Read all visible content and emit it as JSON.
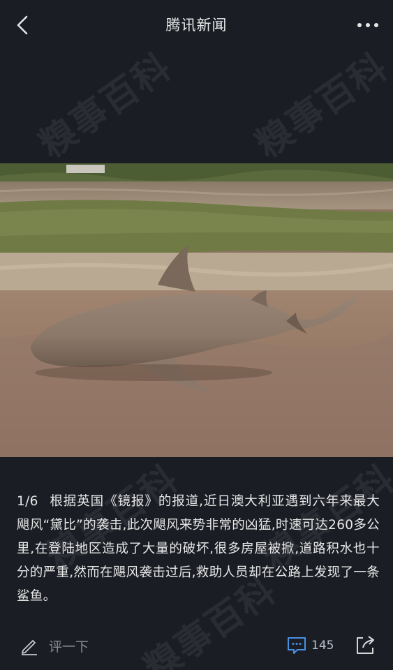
{
  "header": {
    "back_icon": "chevron-left-icon",
    "title": "腾讯新闻",
    "more_icon": "more-dots-icon"
  },
  "watermark": {
    "text": "糗事百科"
  },
  "photo": {
    "subject": "shark-on-flooded-road"
  },
  "caption": {
    "index": "1/6",
    "text": "根据英国《镜报》的报道,近日澳大利亚遇到六年来最大飓风“黛比”的袭击,此次飓风来势非常的凶猛,时速可达260多公里,在登陆地区造成了大量的破坏,很多房屋被掀,道路积水也十分的严重,然而在飓风袭击过后,救助人员却在公路上发现了一条鲨鱼。"
  },
  "footer": {
    "comment_placeholder": "评一下",
    "comment_count": "145",
    "accent_color": "#4a90e2"
  }
}
